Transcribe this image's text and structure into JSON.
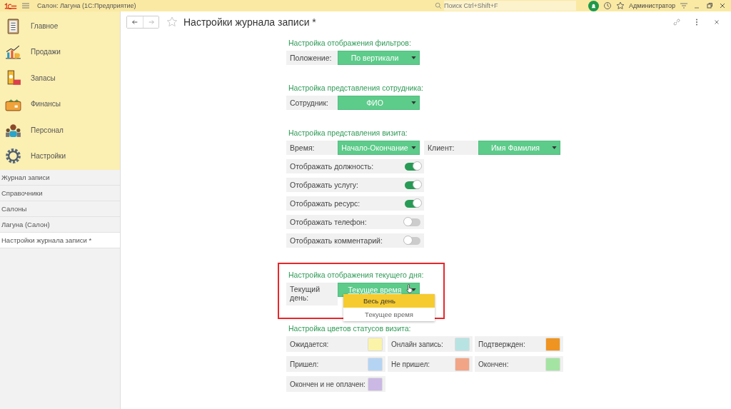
{
  "header": {
    "app_title": "Салон: Лагуна  (1С:Предприятие)",
    "search_placeholder": "Поиск Ctrl+Shift+F",
    "user": "Администратор"
  },
  "sections": [
    {
      "label": "Главное"
    },
    {
      "label": "Продажи"
    },
    {
      "label": "Запасы"
    },
    {
      "label": "Финансы"
    },
    {
      "label": "Персонал"
    },
    {
      "label": "Настройки"
    }
  ],
  "open_pages": [
    {
      "label": "Журнал записи",
      "selected": false
    },
    {
      "label": "Справочники",
      "selected": false
    },
    {
      "label": "Салоны",
      "selected": false
    },
    {
      "label": "Лагуна (Салон)",
      "selected": false
    },
    {
      "label": "Настройки журнала записи *",
      "selected": true
    }
  ],
  "page": {
    "title": "Настройки журнала записи *"
  },
  "filters": {
    "title": "Настройка отображения фильтров:",
    "field": {
      "label": "Положение:",
      "value": "По вертикали"
    }
  },
  "employee": {
    "title": "Настройка представления сотрудника:",
    "field": {
      "label": "Сотрудник:",
      "value": "ФИО"
    }
  },
  "visit": {
    "title": "Настройка представления визита:",
    "time_field": {
      "label": "Время:",
      "value": "Начало-Окончание"
    },
    "client_field": {
      "label": "Клиент:",
      "value": "Имя Фамилия"
    },
    "toggles": [
      {
        "label": "Отображать должность:",
        "on": true
      },
      {
        "label": "Отображать услугу:",
        "on": true
      },
      {
        "label": "Отображать ресурс:",
        "on": true
      },
      {
        "label": "Отображать телефон:",
        "on": false
      },
      {
        "label": "Отображать комментарий:",
        "on": false
      }
    ]
  },
  "current_day": {
    "title": "Настройка отображения текущего дня:",
    "field": {
      "label": "Текущий день:",
      "value": "Текущее время"
    },
    "options": [
      {
        "label": "Весь день",
        "selected": true
      },
      {
        "label": "Текущее время",
        "selected": false
      }
    ]
  },
  "status_colors": {
    "title": "Настройка цветов статусов визита:",
    "items": [
      {
        "label": "Ожидается:",
        "color": "#fbf3a8"
      },
      {
        "label": "Онлайн запись:",
        "color": "#b8e3e3"
      },
      {
        "label": "Подтвержден:",
        "color": "#ef9420"
      },
      {
        "label": "Пришел:",
        "color": "#b5d4f4"
      },
      {
        "label": "Не пришел:",
        "color": "#f2a486"
      },
      {
        "label": "Окончен:",
        "color": "#a4e4a2"
      },
      {
        "label": "Окончен и не оплачен:",
        "color": "#cbb8e4"
      }
    ]
  }
}
